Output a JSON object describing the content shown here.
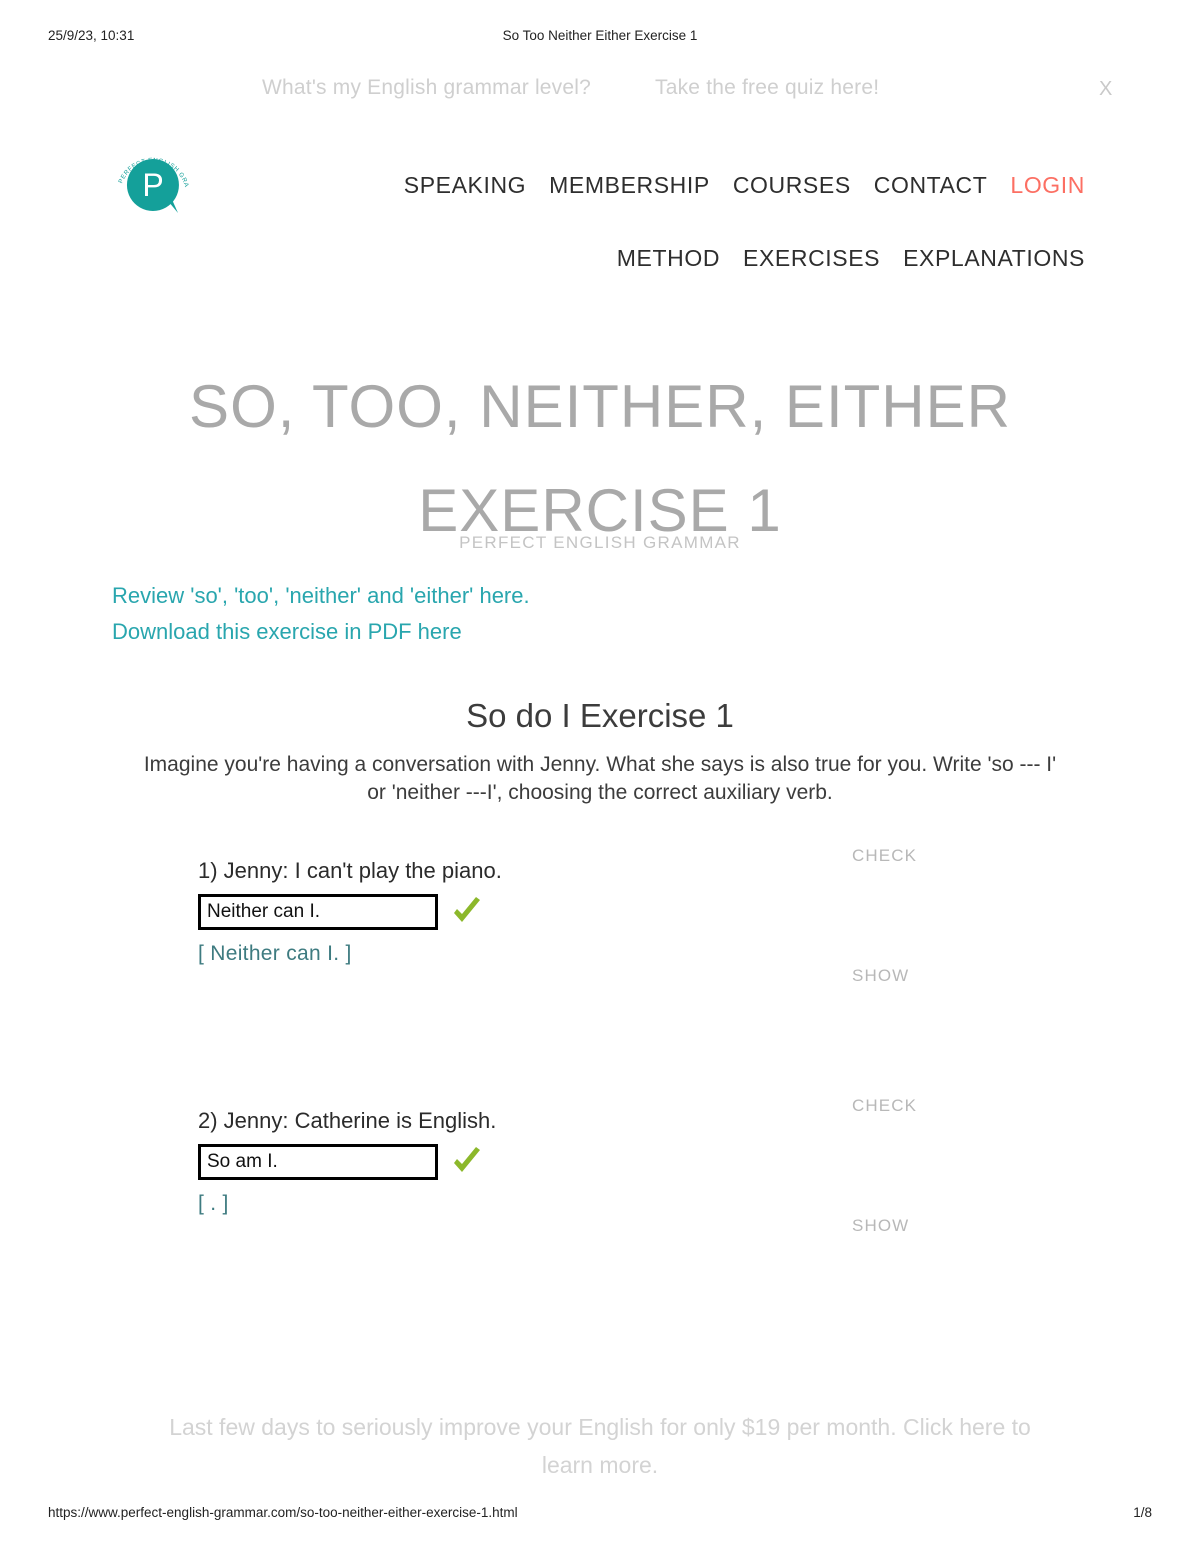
{
  "print_header": {
    "date": "25/9/23, 10:31",
    "title": "So Too Neither Either Exercise 1"
  },
  "promo_banner": {
    "question": "What's my English grammar level?",
    "cta": "Take the free quiz here!",
    "close": "X"
  },
  "logo": {
    "letter": "P",
    "ring_text": "PERFECT ENGLISH GRAMMAR",
    "color": "#14a09a"
  },
  "nav": {
    "row1": [
      {
        "label": "SPEAKING",
        "accent": false
      },
      {
        "label": "MEMBERSHIP",
        "accent": false
      },
      {
        "label": "COURSES",
        "accent": false
      },
      {
        "label": "CONTACT",
        "accent": false
      },
      {
        "label": "LOGIN",
        "accent": true
      }
    ],
    "row2": [
      {
        "label": "METHOD"
      },
      {
        "label": "EXERCISES"
      },
      {
        "label": "EXPLANATIONS"
      }
    ],
    "accent_color": "#fc6f63"
  },
  "page": {
    "title": "SO, TOO, NEITHER, EITHER EXERCISE 1",
    "subtitle": "PERFECT ENGLISH GRAMMAR",
    "review_link": "Review 'so', 'too', 'neither' and 'either' here.",
    "pdf_link": "Download this exercise in PDF here",
    "link_color": "#29a6ae"
  },
  "exercise": {
    "heading": "So do I Exercise 1",
    "instructions": "Imagine you're having a conversation with Jenny. What she says is also true for you. Write 'so --- I' or 'neither ---I', choosing the correct auxiliary verb.",
    "check_label": "CHECK",
    "show_label": "SHOW",
    "questions": [
      {
        "prompt": "1) Jenny: I can't play the piano.",
        "input_value": "Neither can I.",
        "placeholder": "",
        "correct": true,
        "feedback": "[ Neither can I. ]"
      },
      {
        "prompt": "2) Jenny: Catherine is English.",
        "input_value": "So am I.",
        "placeholder": "",
        "correct": true,
        "feedback": "[ . ]"
      }
    ]
  },
  "bottom_promo": {
    "text": "Last few days to seriously improve your English for only $19 per month. Click here to learn more."
  },
  "print_footer": {
    "url": "https://www.perfect-english-grammar.com/so-too-neither-either-exercise-1.html",
    "page": "1/8"
  }
}
